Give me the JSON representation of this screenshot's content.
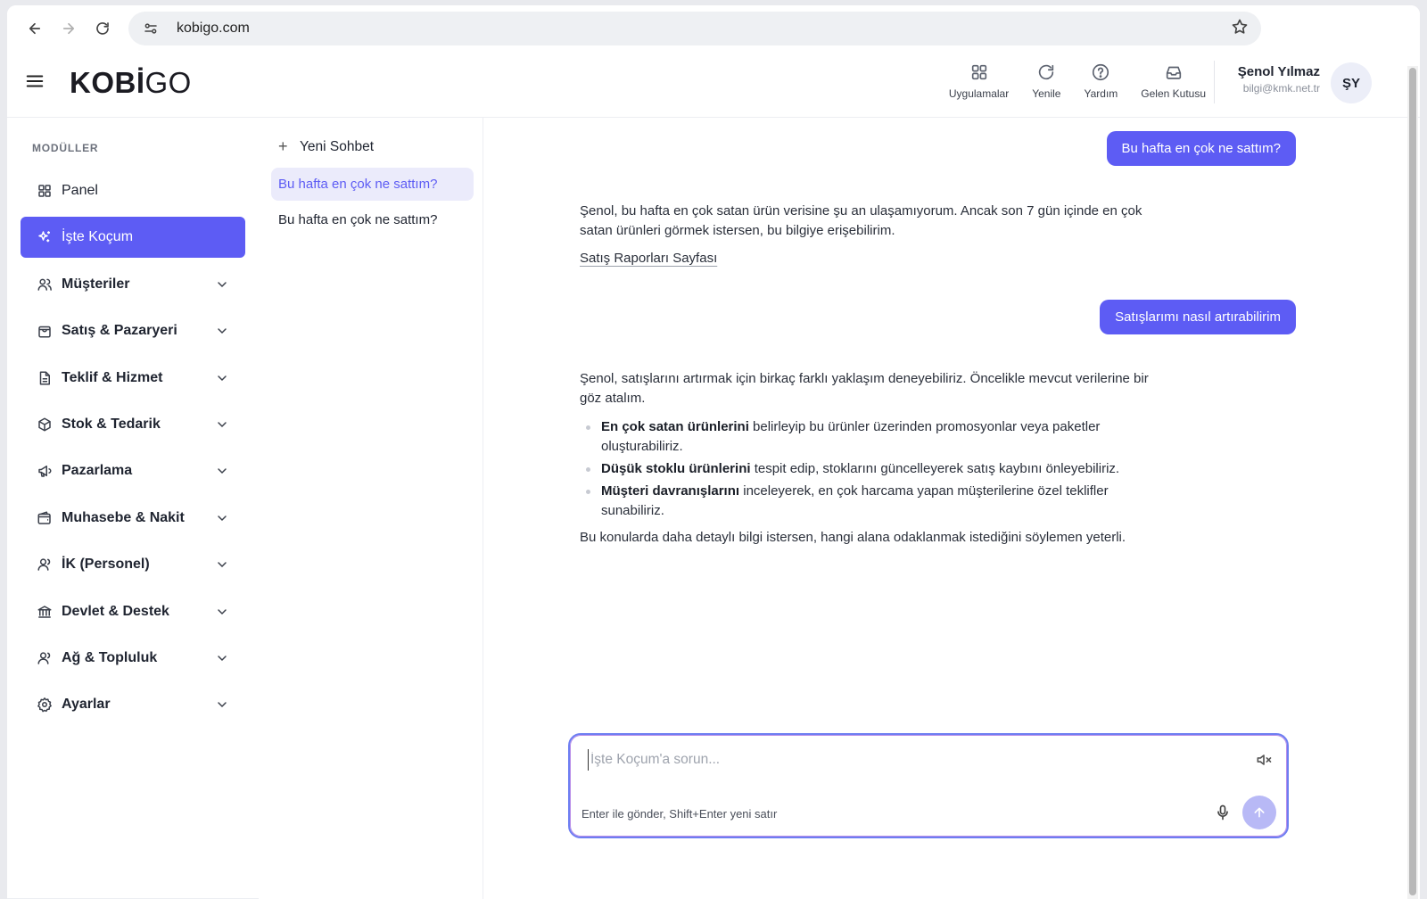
{
  "browser": {
    "url": "kobigo.com"
  },
  "app": {
    "logo_bold": "KOBİ",
    "logo_light": "GO",
    "actions": [
      {
        "label": "Uygulamalar",
        "icon": "grid-icon"
      },
      {
        "label": "Yenile",
        "icon": "refresh-icon"
      },
      {
        "label": "Yardım",
        "icon": "help-icon"
      },
      {
        "label": "Gelen Kutusu",
        "icon": "inbox-icon"
      }
    ],
    "user": {
      "name": "Şenol Yılmaz",
      "email": "bilgi@kmk.net.tr",
      "initials": "ŞY"
    }
  },
  "sidebar": {
    "section_title": "MODÜLLER",
    "items": [
      {
        "label": "Panel",
        "icon": "dashboard-icon",
        "expandable": false,
        "active": false
      },
      {
        "label": "İşte Koçum",
        "icon": "sparkles-icon",
        "expandable": false,
        "active": true
      },
      {
        "label": "Müşteriler",
        "icon": "users-icon",
        "expandable": true
      },
      {
        "label": "Satış & Pazaryeri",
        "icon": "shopping-bag-icon",
        "expandable": true
      },
      {
        "label": "Teklif & Hizmet",
        "icon": "document-icon",
        "expandable": true
      },
      {
        "label": "Stok & Tedarik",
        "icon": "box-icon",
        "expandable": true
      },
      {
        "label": "Pazarlama",
        "icon": "megaphone-icon",
        "expandable": true
      },
      {
        "label": "Muhasebe & Nakit",
        "icon": "wallet-icon",
        "expandable": true
      },
      {
        "label": "İK (Personel)",
        "icon": "user-icon",
        "expandable": true
      },
      {
        "label": "Devlet & Destek",
        "icon": "bank-icon",
        "expandable": true
      },
      {
        "label": "Ağ & Topluluk",
        "icon": "network-icon",
        "expandable": true
      },
      {
        "label": "Ayarlar",
        "icon": "gear-icon",
        "expandable": true
      }
    ]
  },
  "history": {
    "new_chat_label": "Yeni Sohbet",
    "items": [
      {
        "label": "Bu hafta en çok ne sattım?",
        "active": true
      },
      {
        "label": "Bu hafta en çok ne sattım?",
        "active": false
      }
    ]
  },
  "chat": {
    "messages": [
      {
        "role": "user",
        "text": "Bu hafta en çok ne sattım?"
      },
      {
        "role": "assistant",
        "text": "Şenol, bu hafta en çok satan ürün verisine şu an ulaşamıyorum. Ancak son 7 gün içinde en çok satan ürünleri görmek istersen, bu bilgiye erişebilirim.",
        "link": "Satış Raporları Sayfası"
      },
      {
        "role": "user",
        "text": "Satışlarımı nasıl artırabilirim"
      },
      {
        "role": "assistant",
        "intro": "Şenol, satışlarını artırmak için birkaç farklı yaklaşım deneyebiliriz. Öncelikle mevcut verilerine bir göz atalım.",
        "bullets": [
          {
            "bold": "En çok satan ürünlerini",
            "rest": " belirleyip bu ürünler üzerinden promosyonlar veya paketler oluşturabiliriz."
          },
          {
            "bold": "Düşük stoklu ürünlerini",
            "rest": " tespit edip, stoklarını güncelleyerek satış kaybını önleyebiliriz."
          },
          {
            "bold": "Müşteri davranışlarını",
            "rest": " inceleyerek, en çok harcama yapan müşterilerine özel teklifler sunabiliriz."
          }
        ],
        "outro": "Bu konularda daha detaylı bilgi istersen, hangi alana odaklanmak istediğini söylemen yeterli."
      }
    ],
    "composer": {
      "placeholder": "İşte Koçum'a sorun...",
      "value": "",
      "hint": "Enter ile gönder, Shift+Enter yeni satır"
    }
  },
  "colors": {
    "accent": "#5d5cf4",
    "accent_light": "#ebebfb",
    "send_disabled": "#b8b9f6"
  }
}
